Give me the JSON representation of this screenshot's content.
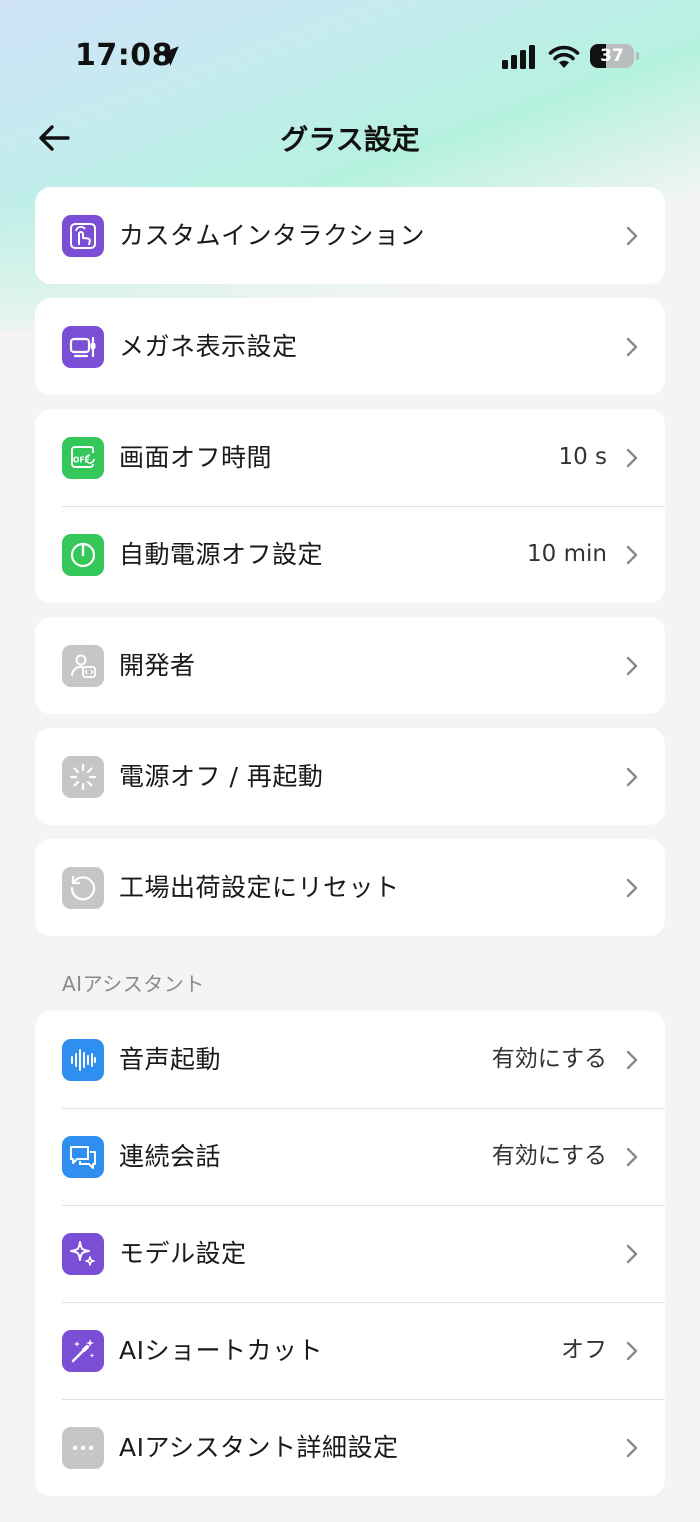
{
  "status": {
    "time": "17:08",
    "battery": "37",
    "battery_level": 0.37
  },
  "header": {
    "title": "グラス設定"
  },
  "groups": [
    {
      "items": [
        {
          "label": "カスタムインタラクション",
          "value": ""
        }
      ]
    },
    {
      "items": [
        {
          "label": "メガネ表示設定",
          "value": ""
        }
      ]
    },
    {
      "items": [
        {
          "label": "画面オフ時間",
          "value": "10 s"
        },
        {
          "label": "自動電源オフ設定",
          "value": "10 min"
        }
      ]
    },
    {
      "items": [
        {
          "label": "開発者",
          "value": ""
        }
      ]
    },
    {
      "items": [
        {
          "label": "電源オフ / 再起動",
          "value": ""
        }
      ]
    },
    {
      "items": [
        {
          "label": "工場出荷設定にリセット",
          "value": ""
        }
      ]
    }
  ],
  "ai_section": {
    "title": "AIアシスタント",
    "items": [
      {
        "label": "音声起動",
        "value": "有効にする"
      },
      {
        "label": "連続会話",
        "value": "有効にする"
      },
      {
        "label": "モデル設定",
        "value": ""
      },
      {
        "label": "AIショートカット",
        "value": "オフ"
      },
      {
        "label": "AIアシスタント詳細設定",
        "value": ""
      }
    ]
  },
  "colors": {
    "purple": "#7a4fd6",
    "green": "#34c759",
    "gray": "#c6c6c6",
    "blue": "#2f8ff0"
  }
}
